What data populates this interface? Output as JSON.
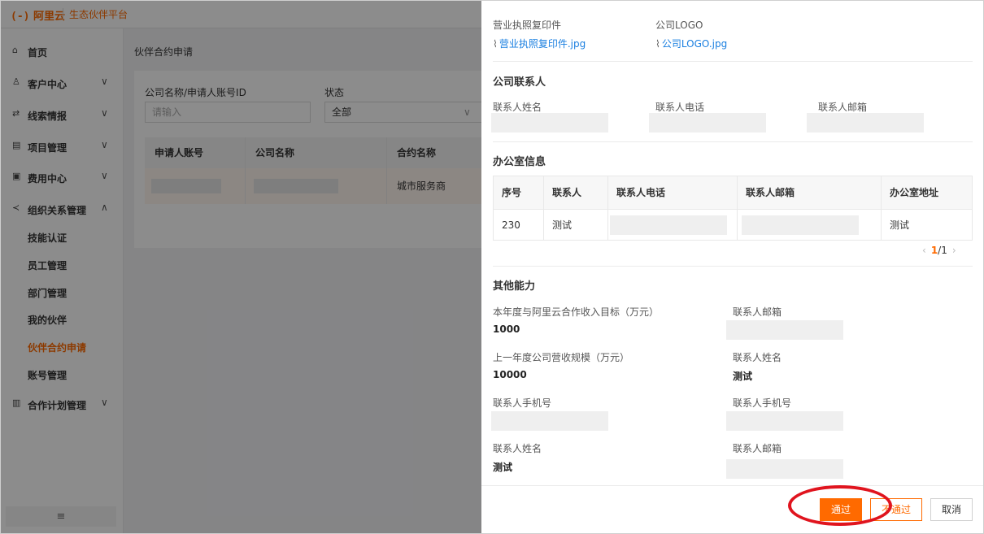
{
  "header": {
    "brand": "阿里云",
    "platform": "生态伙伴平台"
  },
  "sidebar": {
    "items": [
      {
        "label": "首页",
        "icon": "home-icon"
      },
      {
        "label": "客户中心",
        "icon": "user-icon"
      },
      {
        "label": "线索情报",
        "icon": "link-icon"
      },
      {
        "label": "项目管理",
        "icon": "list-icon"
      },
      {
        "label": "费用中心",
        "icon": "wallet-icon"
      },
      {
        "label": "组织关系管理",
        "icon": "share-icon"
      },
      {
        "label": "合作计划管理",
        "icon": "plan-icon"
      }
    ],
    "subitems": [
      "技能认证",
      "员工管理",
      "部门管理",
      "我的伙伴",
      "伙伴合约申请",
      "账号管理"
    ],
    "collapse_glyph": "≡"
  },
  "main": {
    "page_title": "伙伴合约申请",
    "filter": {
      "name_label": "公司名称/申请人账号ID",
      "name_placeholder": "请输入",
      "status_label": "状态",
      "status_value": "全部"
    },
    "table": {
      "headers": [
        "申请人账号",
        "公司名称",
        "合约名称"
      ],
      "row": {
        "contract": "城市服务商"
      }
    }
  },
  "drawer": {
    "license_label": "营业执照复印件",
    "license_file": "营业执照复印件.jpg",
    "logo_label": "公司LOGO",
    "logo_file": "公司LOGO.jpg",
    "contact_section": "公司联系人",
    "contact_fields": [
      "联系人姓名",
      "联系人电话",
      "联系人邮箱"
    ],
    "office_section": "办公室信息",
    "office_table": {
      "headers": [
        "序号",
        "联系人",
        "联系人电话",
        "联系人邮箱",
        "办公室地址"
      ],
      "row": {
        "index": "230",
        "contact": "测试",
        "address": "测试"
      }
    },
    "pager": {
      "current": "1",
      "total": "/1"
    },
    "other_section": "其他能力",
    "other": [
      {
        "label": "本年度与阿里云合作收入目标（万元）",
        "value": "1000"
      },
      {
        "label": "联系人邮箱"
      },
      {
        "label": "上一年度公司营收规模（万元）",
        "value": "10000"
      },
      {
        "label": "联系人姓名",
        "value": "测试"
      },
      {
        "label": "联系人手机号"
      },
      {
        "label": "联系人手机号"
      },
      {
        "label": "联系人姓名",
        "value": "测试"
      },
      {
        "label": "联系人邮箱"
      }
    ],
    "buttons": {
      "approve": "通过",
      "reject": "不通过",
      "cancel": "取消"
    }
  },
  "colors": {
    "accent": "#ff6a00",
    "link": "#1a7fe0",
    "highlight_ring": "#e0141e"
  }
}
